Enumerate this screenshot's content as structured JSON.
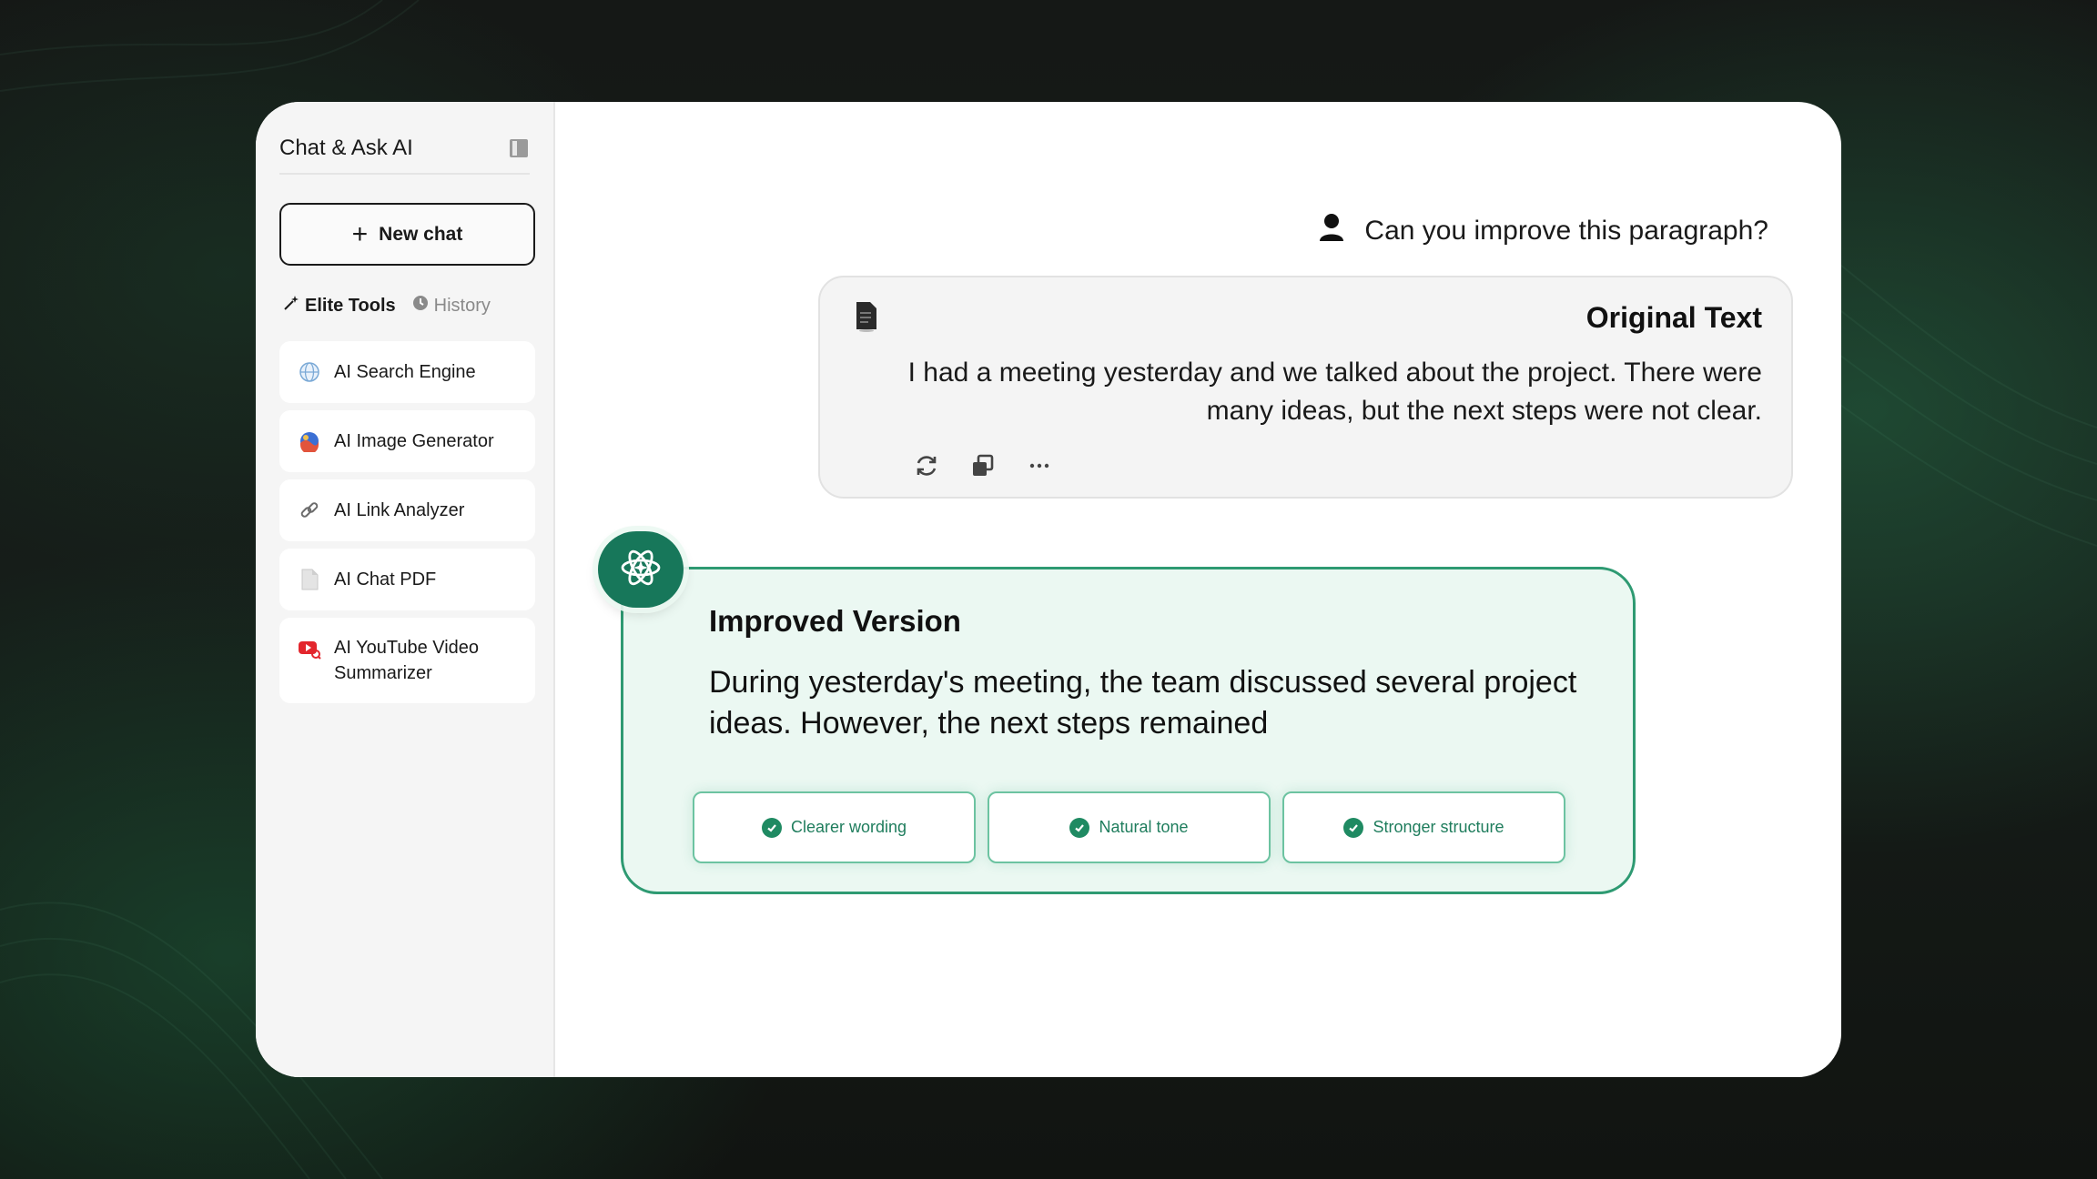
{
  "sidebar": {
    "app_title": "Chat & Ask AI",
    "new_chat_label": "New chat",
    "tabs": [
      {
        "label": "Elite Tools",
        "icon": "magic-wand-icon"
      },
      {
        "label": "History",
        "icon": "clock-icon"
      }
    ],
    "tools": [
      {
        "label": "AI Search Engine",
        "icon": "globe-icon"
      },
      {
        "label": "AI Image Generator",
        "icon": "image-generator-icon"
      },
      {
        "label": "AI Link Analyzer",
        "icon": "link-icon"
      },
      {
        "label": "AI Chat PDF",
        "icon": "document-icon"
      },
      {
        "label": "AI YouTube Video Summarizer",
        "icon": "youtube-icon"
      }
    ]
  },
  "chat": {
    "user_message": "Can you improve this paragraph?",
    "original": {
      "title": "Original Text",
      "text": "I had a meeting yesterday and we talked about the project. There were many ideas, but the next steps were not clear.",
      "actions": [
        "regenerate-icon",
        "copy-icon",
        "more-icon"
      ]
    },
    "improved": {
      "title": "Improved Version",
      "text": "During yesterday's meeting, the team discussed several project ideas. However, the next steps remained",
      "chips": [
        "Clearer wording",
        "Natural tone",
        "Stronger structure"
      ]
    }
  },
  "colors": {
    "accent": "#17775a",
    "improved_bg": "#ebf8f2",
    "improved_border": "#2e9a72"
  }
}
